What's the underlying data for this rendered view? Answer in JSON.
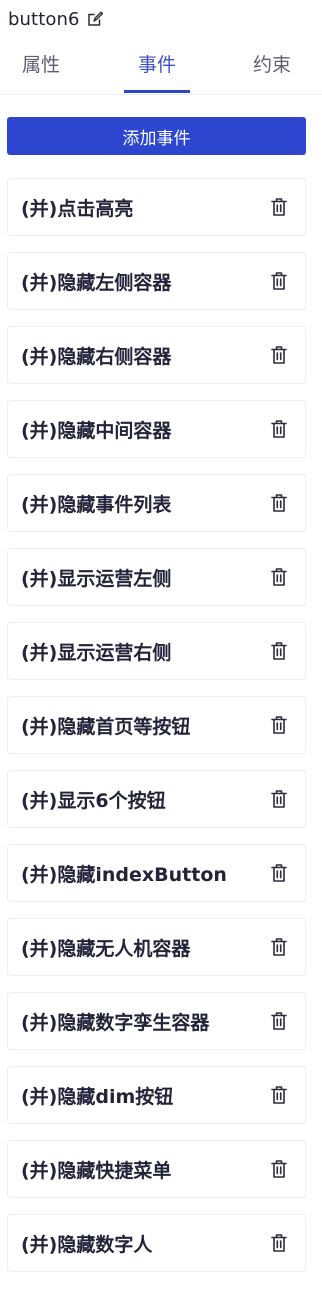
{
  "header": {
    "title": "button6",
    "edit_icon": "edit-icon"
  },
  "tabs": [
    {
      "label": "属性",
      "active": false
    },
    {
      "label": "事件",
      "active": true
    },
    {
      "label": "约束",
      "active": false
    }
  ],
  "actions": {
    "add_event_label": "添加事件"
  },
  "colors": {
    "accent": "#2c46cf",
    "active_tab_text": "#3f50c8",
    "text": "#22253a"
  },
  "events": [
    {
      "label": "(并)点击高亮",
      "icon": "trash-icon"
    },
    {
      "label": "(并)隐藏左侧容器",
      "icon": "trash-icon"
    },
    {
      "label": "(并)隐藏右侧容器",
      "icon": "trash-icon"
    },
    {
      "label": "(并)隐藏中间容器",
      "icon": "trash-icon"
    },
    {
      "label": "(并)隐藏事件列表",
      "icon": "trash-icon"
    },
    {
      "label": "(并)显示运营左侧",
      "icon": "trash-icon"
    },
    {
      "label": "(并)显示运营右侧",
      "icon": "trash-icon"
    },
    {
      "label": "(并)隐藏首页等按钮",
      "icon": "trash-icon"
    },
    {
      "label": "(并)显示6个按钮",
      "icon": "trash-icon"
    },
    {
      "label": "(并)隐藏indexButton",
      "icon": "trash-icon"
    },
    {
      "label": "(并)隐藏无人机容器",
      "icon": "trash-icon"
    },
    {
      "label": "(并)隐藏数字孪生容器",
      "icon": "trash-icon"
    },
    {
      "label": "(并)隐藏dim按钮",
      "icon": "trash-icon"
    },
    {
      "label": "(并)隐藏快捷菜单",
      "icon": "trash-icon"
    },
    {
      "label": "(并)隐藏数字人",
      "icon": "trash-icon"
    }
  ]
}
